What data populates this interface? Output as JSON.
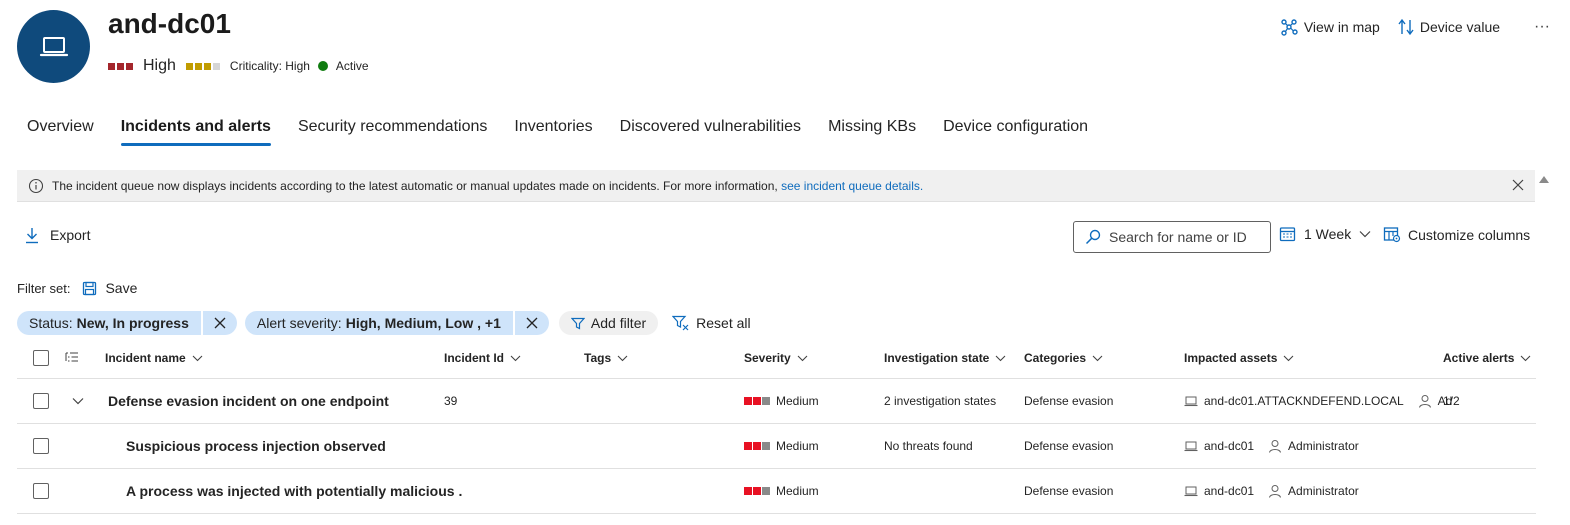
{
  "device": {
    "name": "and-dc01",
    "risk_label": "High",
    "criticality_text": "Criticality: High",
    "status_text": "Active"
  },
  "header_actions": {
    "view_in_map": "View in map",
    "device_value": "Device value",
    "more": "···"
  },
  "tabs": [
    "Overview",
    "Incidents and alerts",
    "Security recommendations",
    "Inventories",
    "Discovered vulnerabilities",
    "Missing KBs",
    "Device configuration"
  ],
  "infobar": {
    "text": "The incident queue now displays incidents according to the latest automatic or manual updates made on incidents. For more information,",
    "link": "see incident queue details."
  },
  "toolbar": {
    "export": "Export",
    "search_placeholder": "Search for name or ID",
    "time_range": "1 Week",
    "customize_columns": "Customize columns"
  },
  "filter_set": {
    "label": "Filter set:",
    "save": "Save"
  },
  "filters": [
    {
      "key": "Status:",
      "value": "New, In progress"
    },
    {
      "key": "Alert severity:",
      "value": "High, Medium, Low , +1"
    }
  ],
  "filter_actions": {
    "add_filter": "Add filter",
    "reset_all": "Reset all"
  },
  "columns": [
    "Incident name",
    "Incident Id",
    "Tags",
    "Severity",
    "Investigation state",
    "Categories",
    "Impacted assets",
    "Active alerts"
  ],
  "rows": [
    {
      "name": "Defense evasion incident on one endpoint",
      "id": "39",
      "severity": "Medium",
      "investigation": "2 investigation states",
      "category": "Defense evasion",
      "asset_device": "and-dc01.ATTACKNDEFEND.LOCAL",
      "asset_user": "Ad",
      "active_alerts": "1/2"
    },
    {
      "name": "Suspicious process injection observed",
      "id": "",
      "severity": "Medium",
      "investigation": "No threats found",
      "category": "Defense evasion",
      "asset_device": "and-dc01",
      "asset_user": "Administrator",
      "active_alerts": ""
    },
    {
      "name": "A process was injected with potentially malicious .",
      "id": "",
      "severity": "Medium",
      "investigation": "",
      "category": "Defense evasion",
      "asset_device": "and-dc01",
      "asset_user": "Administrator",
      "active_alerts": ""
    }
  ],
  "colors": {
    "accent": "#0f6cbd",
    "avatar_bg": "#0f4a7c",
    "risk_high": "#a4262c",
    "criticality_high": "#c19c00",
    "status_active": "#107c10",
    "severity_medium": "#e81123",
    "chip_bg": "#cfe4fa"
  },
  "icons": {
    "avatar": "laptop-icon",
    "view_in_map": "graph-icon",
    "device_value": "sort-arrows-icon",
    "info": "info-icon",
    "close": "close-icon",
    "export": "download-icon",
    "search": "search-icon",
    "calendar": "calendar-icon",
    "customize": "customize-columns-icon",
    "save": "save-icon",
    "filter": "filter-icon",
    "reset": "filter-reset-icon",
    "device": "laptop-icon",
    "user": "person-icon",
    "group": "group-by-icon",
    "expand": "chevron-down-icon"
  }
}
